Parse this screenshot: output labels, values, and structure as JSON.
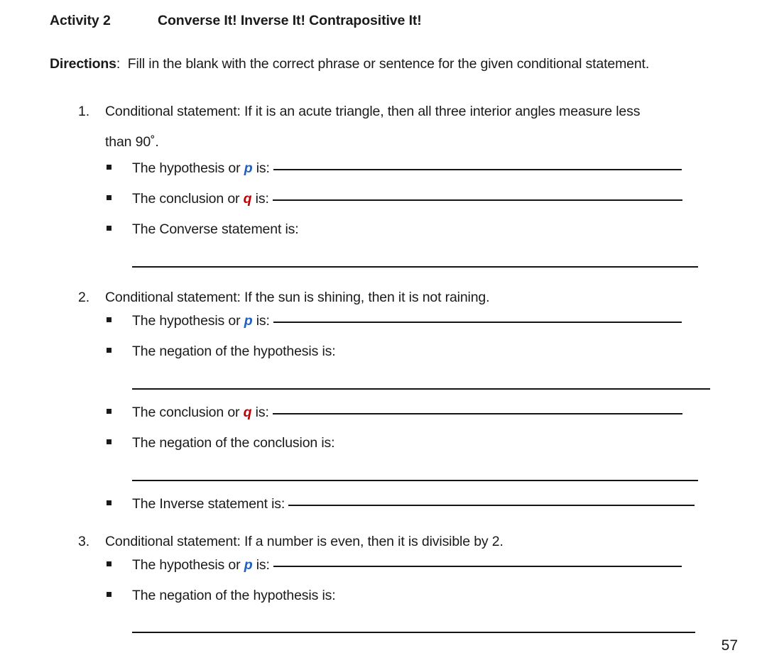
{
  "heading": {
    "activity_label": "Activity 2",
    "activity_title": "Converse It! Inverse It! Contrapositive It!"
  },
  "directions": {
    "label": "Directions",
    "separator": ":",
    "text": "Fill in the blank with the correct phrase or sentence for the given conditional statement."
  },
  "colors": {
    "p_accent": "#1F5FBF",
    "q_accent": "#C00000",
    "text": "#1a1a1a",
    "rule": "#141414",
    "background": "#ffffff"
  },
  "icons": {
    "bullet": "square-bullet-icon"
  },
  "items": [
    {
      "number": "1.",
      "statement_line1": "Conditional statement: If it is an acute triangle, then all three interior angles measure less",
      "statement_line2": "than 90˚.",
      "bullets": [
        {
          "prefix": "The hypothesis or ",
          "variable": "p",
          "variable_color": "p",
          "suffix": " is:",
          "blank": "inline"
        },
        {
          "prefix": "The conclusion or ",
          "variable": "q",
          "variable_color": "q",
          "suffix": " is:",
          "blank": "inline"
        },
        {
          "prefix": "The Converse statement is:",
          "variable": "",
          "variable_color": "",
          "suffix": "",
          "blank": "below"
        }
      ]
    },
    {
      "number": "2.",
      "statement_line1": "Conditional statement: If the sun is shining, then it is not raining.",
      "statement_line2": "",
      "bullets": [
        {
          "prefix": "The hypothesis or ",
          "variable": "p",
          "variable_color": "p",
          "suffix": " is:",
          "blank": "inline"
        },
        {
          "prefix": "The negation of the hypothesis is:",
          "variable": "",
          "variable_color": "",
          "suffix": "",
          "blank": "below"
        },
        {
          "prefix": "The conclusion or ",
          "variable": "q",
          "variable_color": "q",
          "suffix": " is:",
          "blank": "inline"
        },
        {
          "prefix": "The negation of the conclusion is:",
          "variable": "",
          "variable_color": "",
          "suffix": "",
          "blank": "below"
        },
        {
          "prefix": "The Inverse statement is:",
          "variable": "",
          "variable_color": "",
          "suffix": "",
          "blank": "inline"
        }
      ]
    },
    {
      "number": "3.",
      "statement_line1": "Conditional statement: If a number is even, then it is divisible by 2.",
      "statement_line2": "",
      "bullets": [
        {
          "prefix": "The hypothesis or ",
          "variable": "p",
          "variable_color": "p",
          "suffix": " is:",
          "blank": "inline"
        },
        {
          "prefix": "The negation of the hypothesis is:",
          "variable": "",
          "variable_color": "",
          "suffix": "",
          "blank": "below"
        }
      ]
    }
  ],
  "footer": {
    "page_number": "57"
  }
}
